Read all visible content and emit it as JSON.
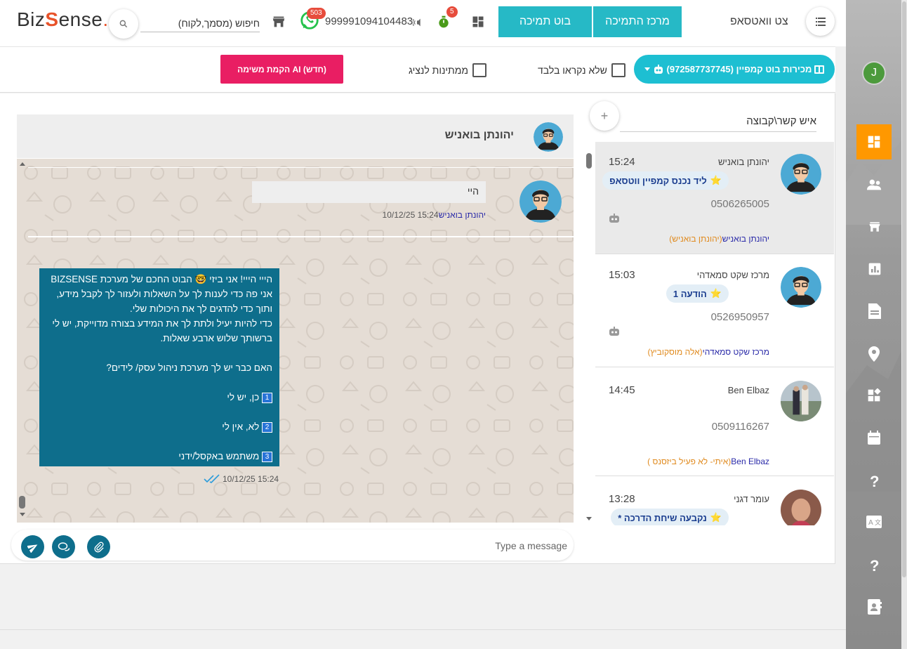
{
  "app": {
    "logo_prefix": "Biz",
    "logo_s": "S",
    "logo_suffix": "ense",
    "logo_dot": "."
  },
  "topbar": {
    "search_placeholder": "חיפוש (מסמך,לקוח)",
    "whatsapp_badge": "503",
    "whatsapp_number": "999991094104483",
    "timer_badge": "5",
    "bot_support_button": "בוט תמיכה",
    "support_center_button": "מרכז התמיכה",
    "title": "צט וואטסאפ"
  },
  "filterbar": {
    "campaign_button": "מכירות בוט קמפיין (972587737745)",
    "unread_only_label": "שלא נקראו בלבד",
    "waiting_agent_label": "ממתינות לנציג",
    "ai_task_button": "הקמת משימה AI (חדש)"
  },
  "contacts_panel": {
    "search_placeholder": "איש קשר\\קבוצה",
    "add_symbol": "+",
    "contacts": [
      {
        "name": "יהונתן בואניש",
        "time": "15:24",
        "tag": "ליד נכנס קמפיין ווטסאפ",
        "phone": "0506265005",
        "owner": "יהונתן בואניש",
        "group": "(יהונתן בואניש)",
        "active": true
      },
      {
        "name": "מרכז שקט סמאדהי",
        "time": "15:03",
        "tag": "הודעה 1",
        "phone": "0526950957",
        "owner": "מרכז שקט סמאדהי",
        "group": "(אלה מוסקוביץ)",
        "active": false
      },
      {
        "name": "Ben Elbaz",
        "time": "14:45",
        "tag": "",
        "phone": "0509116267",
        "owner": "Ben Elbaz",
        "group": "(איתי- לא פעיל ביזסנס )",
        "active": false
      },
      {
        "name": "עומר דגני",
        "time": "13:28",
        "tag": "נקבעה שיחת הדרכה *",
        "phone": "",
        "owner": "",
        "group": "",
        "active": false
      }
    ]
  },
  "chat": {
    "contact_name": "יהונתן בואניש",
    "incoming": {
      "text": "היי",
      "datetime": "10/12/25 15:24",
      "sender": "יהונתן בואניש"
    },
    "outgoing": {
      "line1": "הייי הייי! אני ביזי 🤓 הבוט החכם של מערכת BIZSENSE",
      "line2": "אני פה כדי לענות לך על השאלות ולעזור לך לקבל מידע,",
      "line3": "ותוך כדי להדגים לך את היכולות שלי.",
      "line4": "כדי להיות יעיל ולתת לך את המידע בצורה מדוייקת, יש לי",
      "line5": "ברשותך שלוש ארבע שאלות.",
      "question": "האם כבר יש לך מערכת ניהול עסק/ לידים?",
      "option1_num": "1",
      "option1": "כן, יש לי",
      "option2_num": "2",
      "option2": "לא, אין לי",
      "option3_num": "3",
      "option3": "משתמש באקסל/ידני",
      "datetime": "10/12/25 15:24"
    },
    "input_placeholder": "Type a message"
  },
  "user": {
    "initial": "J"
  },
  "colors": {
    "accent_teal": "#26b9c6",
    "campaign_cyan": "#1dbfd2",
    "ai_pink": "#e91e63",
    "outgoing_bubble": "#0e6e8c",
    "sidebar_active": "#ff9800"
  },
  "sidebar_icons": [
    "dashboard-icon",
    "users-icon",
    "store-icon",
    "chart-icon",
    "document-icon",
    "location-icon",
    "widgets-icon",
    "calendar-icon",
    "help-icon",
    "translate-icon",
    "help-icon",
    "contacts-book-icon"
  ]
}
